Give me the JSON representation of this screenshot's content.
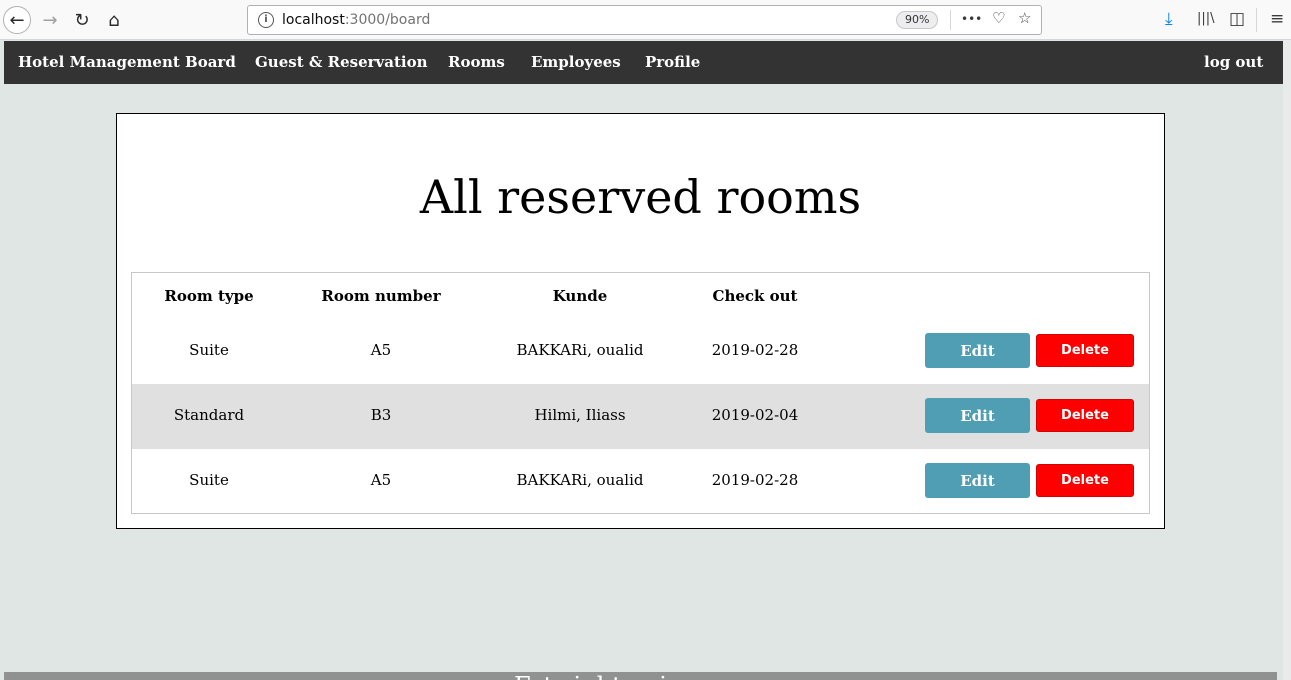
{
  "browser": {
    "url_host": "localhost",
    "url_path": ":3000/board",
    "zoom": "90%",
    "back_glyph": "←",
    "forward_glyph": "→",
    "reload_glyph": "↻",
    "home_glyph": "⌂",
    "info_glyph": "i",
    "page_actions_glyph": "•••",
    "pocket_glyph": "♡",
    "bookmark_glyph": "☆",
    "download_glyph": "⤓",
    "library_glyph": "|||\\",
    "sidebar_glyph": "◫",
    "menu_glyph": "≡"
  },
  "navbar": {
    "brand": "Hotel Management Board",
    "items": [
      "Guest & Reservation",
      "Rooms",
      "Employees",
      "Profile"
    ],
    "logout": "log out"
  },
  "main": {
    "title": "All reserved rooms",
    "table": {
      "headers": [
        "Room type",
        "Room number",
        "Kunde",
        "Check out"
      ],
      "edit_label": "Edit",
      "delete_label": "Delete",
      "rows": [
        {
          "room_type": "Suite",
          "room_number": "A5",
          "kunde": "BAKKARi, oualid",
          "check_out": "2019-02-28"
        },
        {
          "room_type": "Standard",
          "room_number": "B3",
          "kunde": "Hilmi, Iliass",
          "check_out": "2019-02-04"
        },
        {
          "room_type": "Suite",
          "room_number": "A5",
          "kunde": "BAKKARi, oualid",
          "check_out": "2019-02-28"
        }
      ]
    }
  },
  "footer": {
    "text": "Fatwight oui"
  }
}
